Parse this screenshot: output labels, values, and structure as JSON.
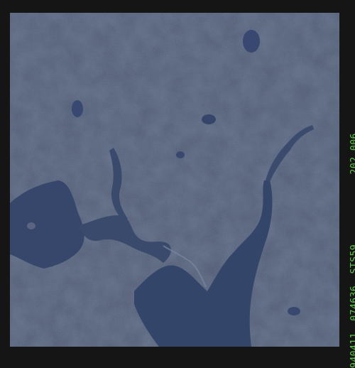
{
  "photo": {
    "subject": "orbital-earth-observation"
  },
  "frame_info": {
    "date_code": "940411",
    "time_code": "074636",
    "mission": "STS59",
    "roll_frame": "202 006",
    "text_color": "#5ec84a"
  },
  "colors": {
    "land": "#4a5670",
    "water": "#34456a",
    "border": "#151515"
  }
}
